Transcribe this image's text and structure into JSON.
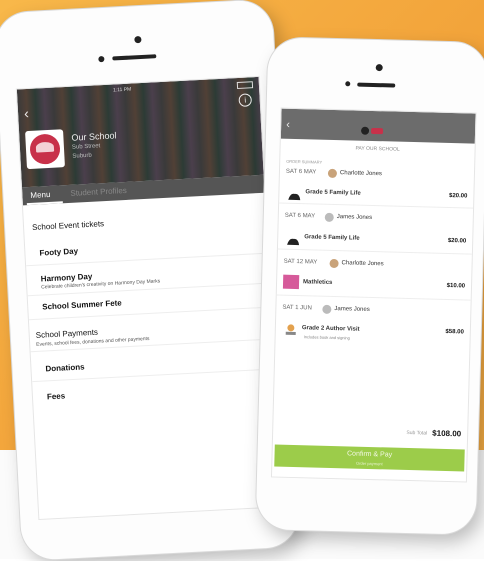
{
  "left_app": {
    "status_time": "1:11 PM",
    "school": {
      "name": "Our School",
      "subtitle1": "Sub Street",
      "subtitle2": "Suburb"
    },
    "tabs": [
      {
        "label": "Menu"
      },
      {
        "label": "Student Profiles"
      }
    ],
    "menu": {
      "section1": "School Event tickets",
      "items": [
        {
          "label": "Footy Day"
        },
        {
          "label": "Harmony Day",
          "desc": "Celebrate children's creativity on Harmony Day Marks"
        },
        {
          "label": "School Summer Fete"
        }
      ],
      "section2": "School Payments",
      "section2_desc": "Events, school fees, donations and other payments",
      "items2": [
        {
          "label": "Donations"
        },
        {
          "label": "Fees"
        }
      ]
    }
  },
  "right_app": {
    "title": "PAY OUR SCHOOL",
    "label": "ORDER SUMMARY",
    "orders": [
      {
        "date": "SAT 6 MAY",
        "person": "Charlotte Jones",
        "item": "Grade 5 Family Life",
        "price": "$20.00"
      },
      {
        "date": "SAT 6 MAY",
        "person": "James Jones",
        "item": "Grade 5 Family Life",
        "price": "$20.00"
      },
      {
        "date": "SAT 12 MAY",
        "person": "Charlotte Jones",
        "item": "Mathletics",
        "price": "$10.00"
      },
      {
        "date": "SAT 1 JUN",
        "person": "James Jones",
        "item": "Grade 2 Author Visit",
        "price": "$58.00",
        "desc": "Includes book and signing"
      }
    ],
    "total_label": "Sub Total",
    "total": "$108.00",
    "confirm_label": "Confirm & Pay",
    "confirm_sub": "Order payment"
  },
  "colors": {
    "background_orange": "#f2a33a",
    "confirm_green": "#9ccc4a",
    "logo_red": "#c8314a"
  }
}
